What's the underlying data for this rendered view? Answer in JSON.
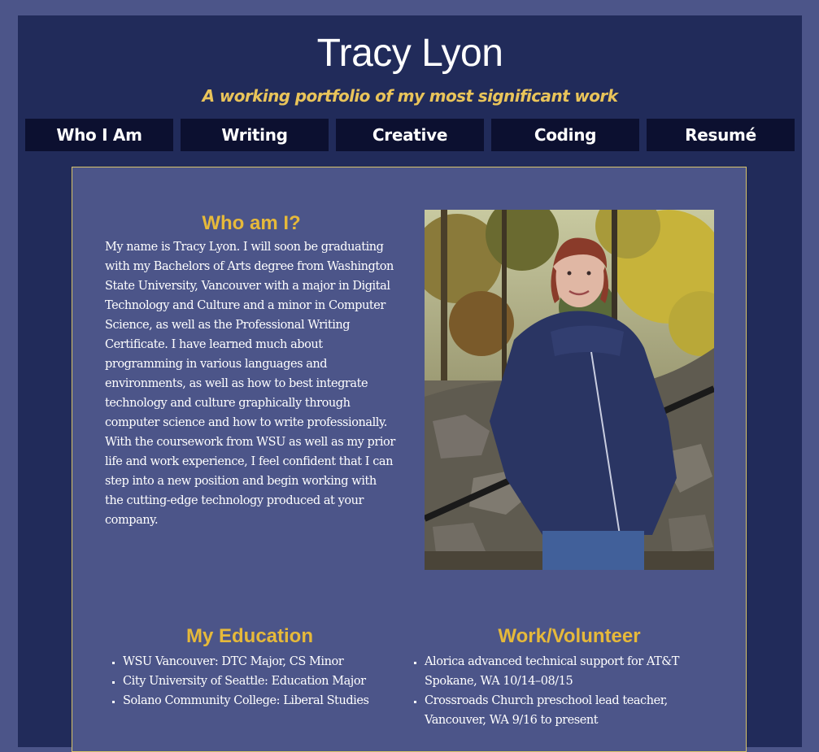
{
  "header": {
    "title": "Tracy Lyon",
    "tagline": "A working portfolio of my most significant work"
  },
  "nav": {
    "items": [
      "Who I Am",
      "Writing",
      "Creative",
      "Coding",
      "Resumé"
    ]
  },
  "about": {
    "heading": "Who am I?",
    "body": "My name is Tracy Lyon. I will soon be graduating with my Bachelors of Arts degree from Washington State University, Vancouver with a major in Digital Technology and Culture and a minor in Computer Science, as well as the Professional Writing Certificate. I have learned much about programming in various languages and environments, as well as how to best integrate technology and culture graphically through computer science and how to write professionally. With the coursework from WSU as well as my prior life and work experience, I feel confident that I can step into a new position and begin working with the cutting-edge technology produced at your company."
  },
  "photo": {
    "subject": "portrait-photo"
  },
  "education": {
    "heading": "My Education",
    "items": [
      "WSU Vancouver: DTC Major, CS Minor",
      "City University of Seattle: Education Major",
      "Solano Community College: Liberal Studies"
    ]
  },
  "work": {
    "heading": "Work/Volunteer",
    "items": [
      "Alorica advanced technical support for AT&T Spokane, WA 10/14–08/15",
      "Crossroads Church preschool lead teacher, Vancouver, WA 9/16 to present"
    ]
  },
  "colors": {
    "page_bg": "#4c5589",
    "frame_bg": "#212b5a",
    "nav_bg": "#0c1030",
    "accent_gold": "#e6b93a",
    "tagline_gold": "#e9c45a",
    "panel_border": "#d8c369"
  }
}
